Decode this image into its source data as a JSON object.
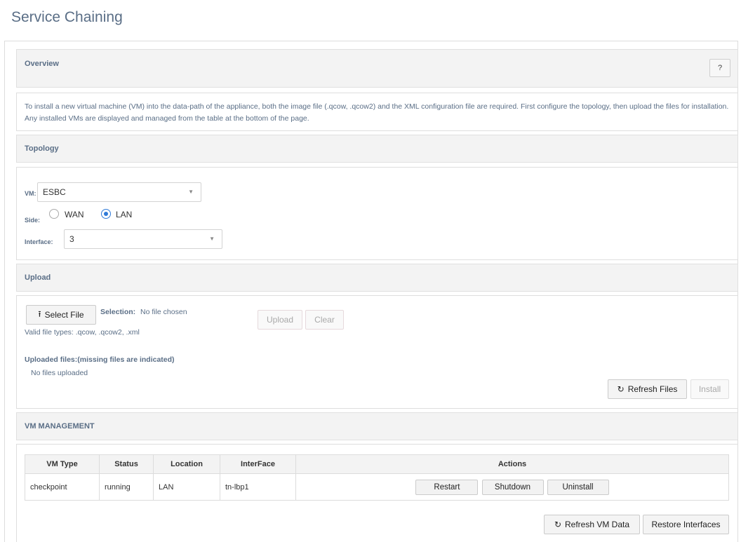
{
  "page": {
    "title": "Service Chaining"
  },
  "overview": {
    "title": "Overview",
    "help_label": "?",
    "text": "To install a new virtual machine (VM) into the data-path of the appliance, both the image file (.qcow, .qcow2) and the XML configuration file are required. First configure the topology, then upload the files for installation. Any installed VMs are displayed and managed from the table at the bottom of the page."
  },
  "topology": {
    "title": "Topology",
    "vm_label": "VM:",
    "vm_value": "ESBC",
    "side_label": "Side:",
    "side_options": [
      "WAN",
      "LAN"
    ],
    "side_selected": "LAN",
    "interface_label": "Interface:",
    "interface_value": "3"
  },
  "upload": {
    "title": "Upload",
    "select_file_label": "Select File",
    "selection_label": "Selection:",
    "selection_value": "No file chosen",
    "valid_types": "Valid file types: .qcow, .qcow2, .xml",
    "upload_label": "Upload",
    "clear_label": "Clear",
    "uploaded_title": "Uploaded files:(missing files are indicated)",
    "uploaded_empty": "No files uploaded",
    "refresh_files_label": "Refresh Files",
    "install_label": "Install"
  },
  "vm_management": {
    "title": "VM MANAGEMENT",
    "columns": [
      "VM Type",
      "Status",
      "Location",
      "InterFace",
      "Actions"
    ],
    "rows": [
      {
        "vm_type": "checkpoint",
        "status": "running",
        "location": "LAN",
        "interface": "tn-lbp1"
      }
    ],
    "restart_label": "Restart",
    "shutdown_label": "Shutdown",
    "uninstall_label": "Uninstall",
    "refresh_vm_label": "Refresh VM Data",
    "restore_label": "Restore Interfaces"
  },
  "icons": {
    "upload": "upload-icon",
    "refresh": "refresh-icon",
    "dropdown": "chevron-down-icon"
  },
  "colors": {
    "accent": "#2f7ad8",
    "header_text": "#5a6e86",
    "section_bg": "#f3f3f3"
  }
}
